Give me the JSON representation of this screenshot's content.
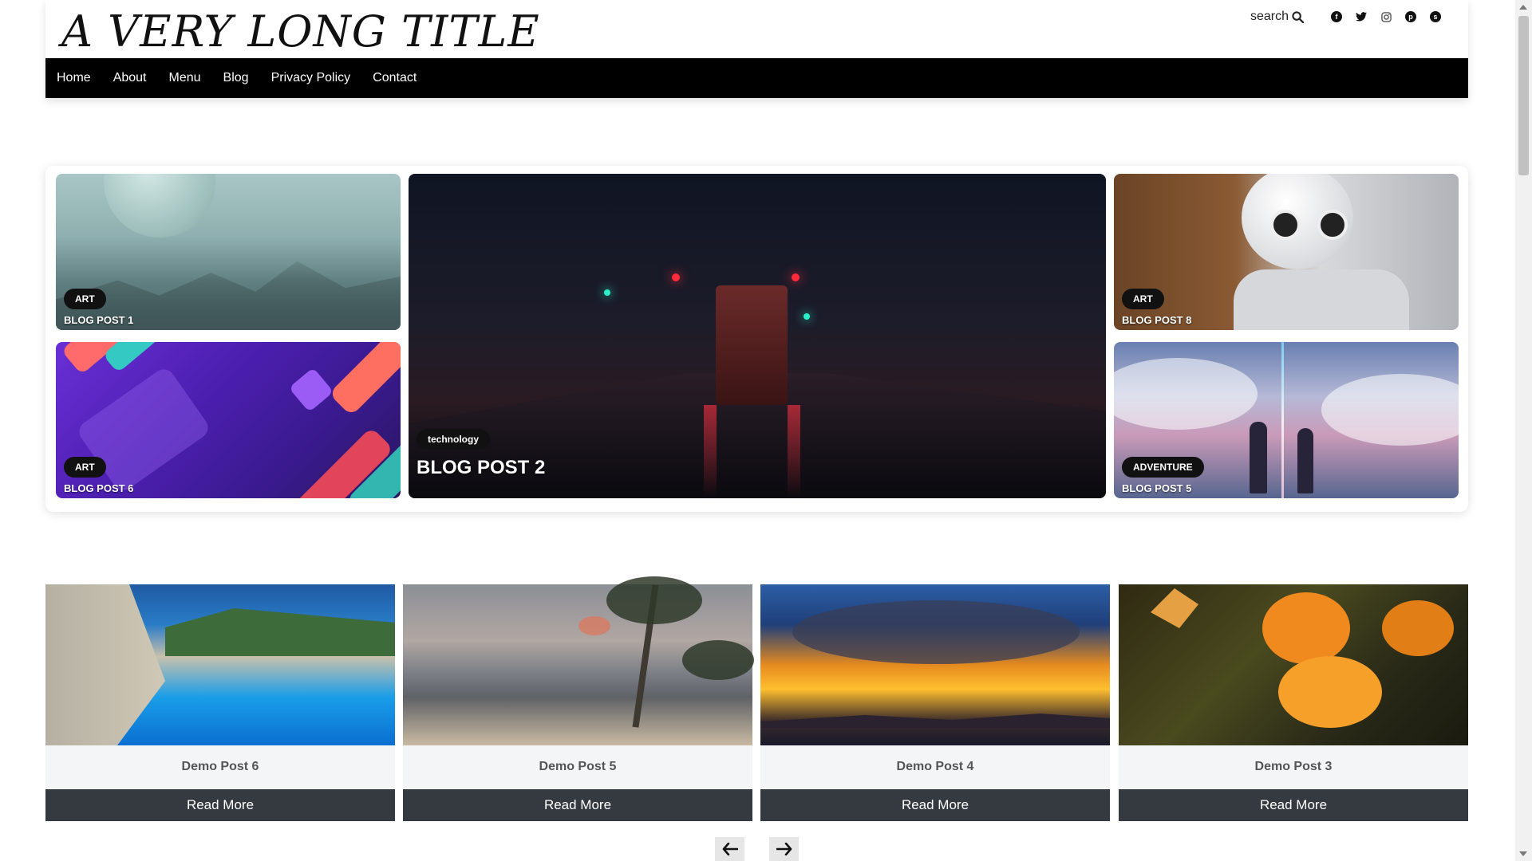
{
  "site": {
    "title": "A VERY LONG TITLE"
  },
  "header": {
    "search_label": "search",
    "social": [
      "facebook-icon",
      "twitter-icon",
      "instagram-icon",
      "pinterest-icon",
      "skype-icon"
    ]
  },
  "nav": {
    "items": [
      {
        "label": "Home"
      },
      {
        "label": "About"
      },
      {
        "label": "Menu"
      },
      {
        "label": "Blog"
      },
      {
        "label": "Privacy Policy"
      },
      {
        "label": "Contact"
      }
    ]
  },
  "featured": {
    "tiles": [
      {
        "category": "ART",
        "title": "BLOG POST 1"
      },
      {
        "category": "ART",
        "title": "BLOG POST 6"
      },
      {
        "category": "technology",
        "title": "BLOG POST 2"
      },
      {
        "category": "ART",
        "title": "BLOG POST 8"
      },
      {
        "category": "ADVENTURE",
        "title": "BLOG POST 5"
      }
    ]
  },
  "posts": {
    "items": [
      {
        "title": "Demo Post 6",
        "button": "Read More"
      },
      {
        "title": "Demo Post 5",
        "button": "Read More"
      },
      {
        "title": "Demo Post 4",
        "button": "Read More"
      },
      {
        "title": "Demo Post 3",
        "button": "Read More"
      }
    ],
    "prev_icon": "arrow-left-icon",
    "next_icon": "arrow-right-icon"
  },
  "colors": {
    "nav_bg": "#000000",
    "button_bg": "#343a40",
    "pill_bg": "#111111"
  }
}
